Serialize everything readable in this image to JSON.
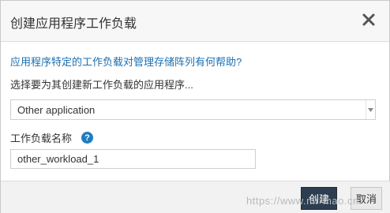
{
  "dialog": {
    "title": "创建应用程序工作负载",
    "close_icon": "close-icon"
  },
  "form": {
    "help_link": "应用程序特定的工作负载对管理存储阵列有何帮助?",
    "select_prompt": "选择要为其创建新工作负载的应用程序...",
    "application_select_value": "Other application",
    "workload_name_label": "工作负载名称",
    "help_icon_glyph": "?",
    "workload_name_value": "other_workload_1"
  },
  "footer": {
    "create_label": "创建",
    "cancel_label": "取消"
  },
  "watermark": "https://www.mr-mao.cn",
  "colors": {
    "link": "#1a6fb0",
    "primary_button": "#2c3e50",
    "help_icon": "#1f7dc1"
  }
}
